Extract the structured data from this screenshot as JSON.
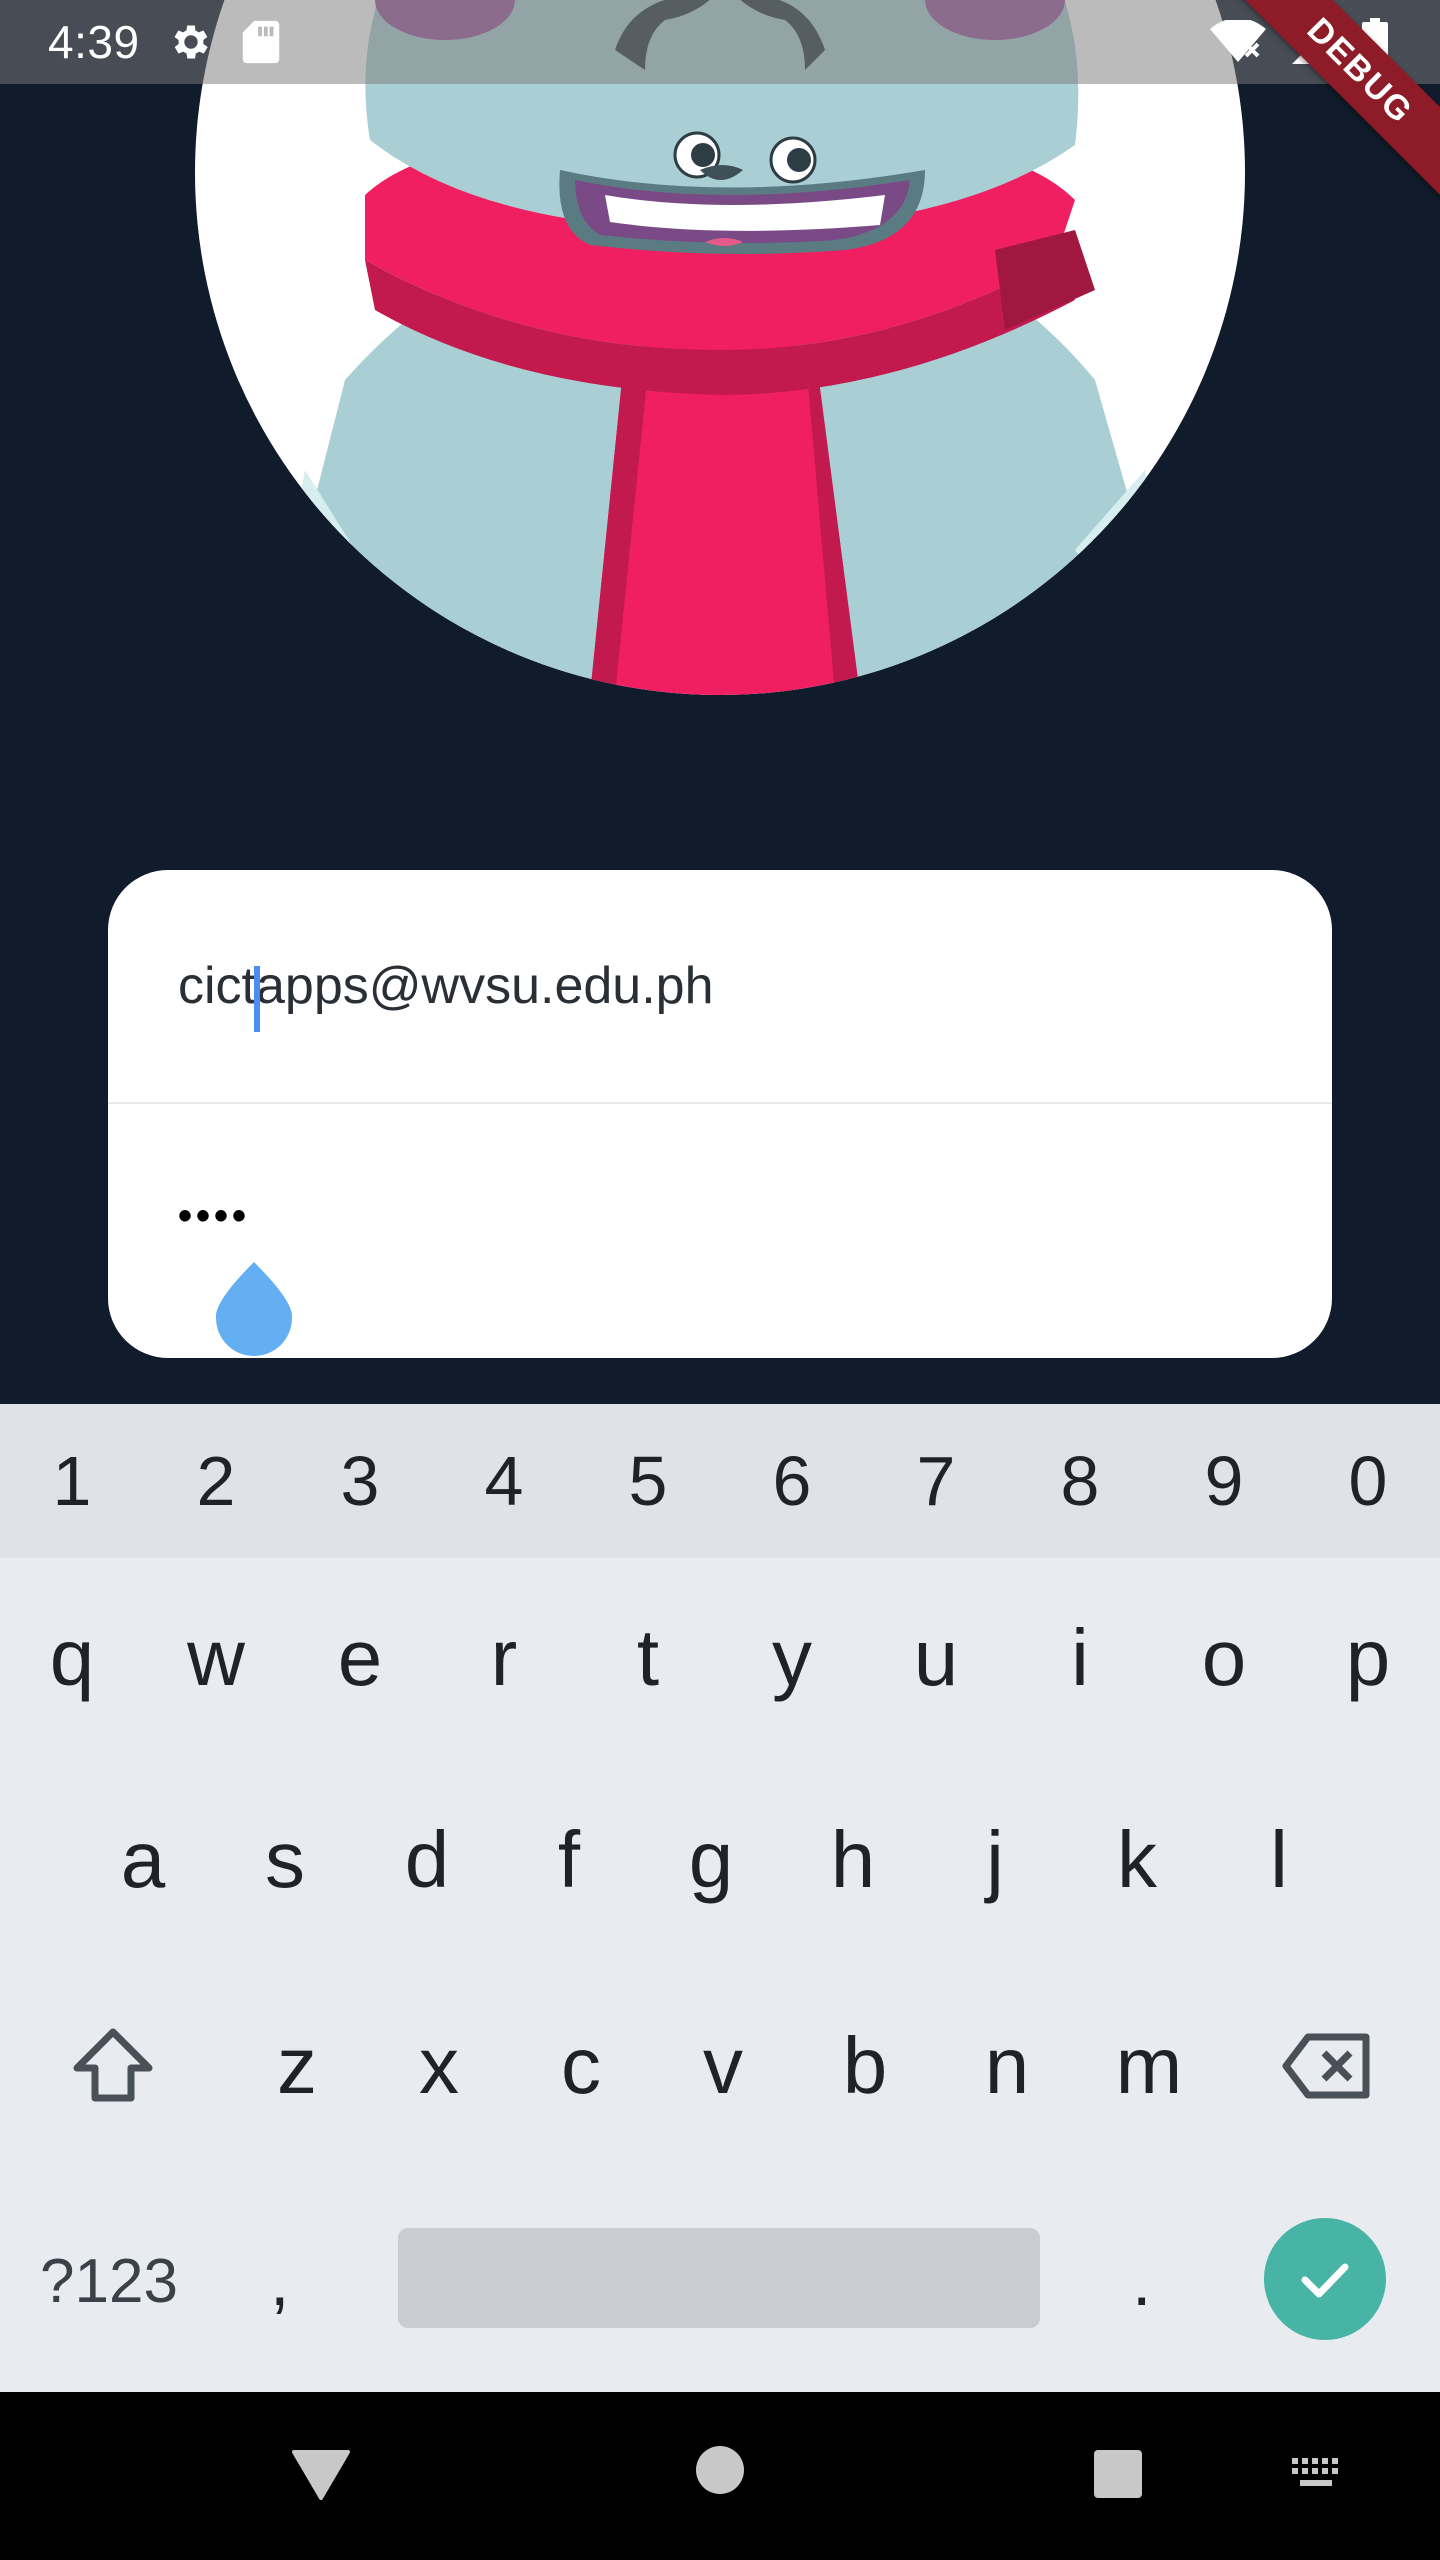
{
  "status_bar": {
    "time": "4:39",
    "left_icons": [
      "gear-icon",
      "sd-card-icon"
    ],
    "right_icons": [
      "wifi-icon",
      "signal-icon",
      "battery-icon"
    ]
  },
  "debug_banner": {
    "label": "DEBUG",
    "color": "#8e1b28"
  },
  "avatar": {
    "description_icon": "yeti-mascot-icon"
  },
  "login": {
    "email_value": "cictapps@wvsu.edu.ph",
    "password_value": "••••"
  },
  "keyboard": {
    "number_row": [
      "1",
      "2",
      "3",
      "4",
      "5",
      "6",
      "7",
      "8",
      "9",
      "0"
    ],
    "row1": [
      "q",
      "w",
      "e",
      "r",
      "t",
      "y",
      "u",
      "i",
      "o",
      "p"
    ],
    "row2": [
      "a",
      "s",
      "d",
      "f",
      "g",
      "h",
      "j",
      "k",
      "l"
    ],
    "row3": [
      "z",
      "x",
      "c",
      "v",
      "b",
      "n",
      "m"
    ],
    "symbols_label": "?123",
    "comma_label": ",",
    "period_label": ".",
    "enter_icon": "check-icon",
    "enter_color": "#48b4a5"
  },
  "nav_bar": {
    "icons": [
      "back-icon",
      "home-icon",
      "recents-icon",
      "keyboard-switch-icon"
    ]
  },
  "colors": {
    "background": "#101b2b",
    "card": "#ffffff",
    "cursor": "#4c8eef",
    "scarf": "#f01f62"
  }
}
